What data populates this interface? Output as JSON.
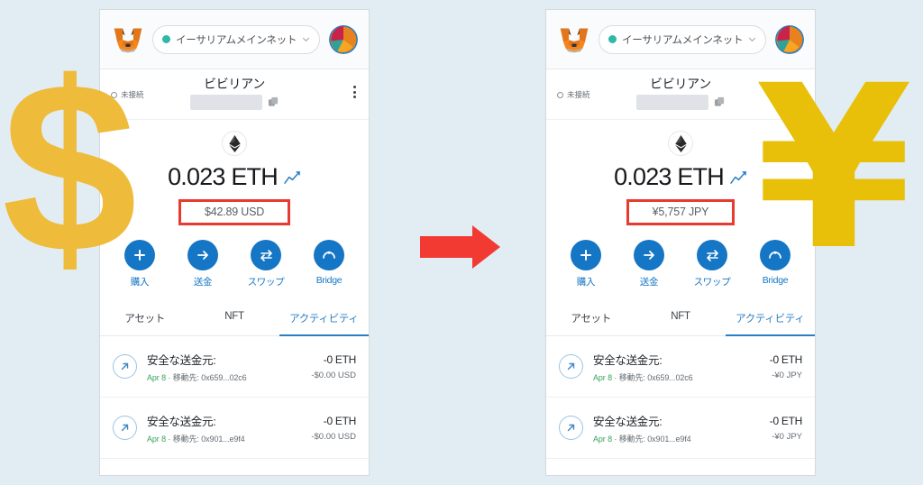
{
  "background_color": "#e2edf3",
  "overlay": {
    "left_symbol": "$",
    "left_symbol_name": "dollar-sign",
    "left_symbol_color": "#efbb3a",
    "right_symbol": "¥",
    "right_symbol_name": "yen-sign",
    "right_symbol_color": "#e8c009",
    "arrow_color": "#f23a32",
    "arrow_direction": "right"
  },
  "panels": [
    {
      "id": "before-usd",
      "topbar": {
        "wallet_logo": "metamask-fox-logo",
        "network_name": "イーサリアムメインネット",
        "network_status_color": "#2db9a5",
        "chevron": "chevron-down-icon",
        "avatar": "account-avatar-jazzicon"
      },
      "account": {
        "connection_status": "未接続",
        "name": "ビビリアン",
        "address_redacted": true,
        "copy_icon": "copy-icon",
        "menu_icon": "kebab-menu-icon"
      },
      "balance": {
        "token_icon": "ethereum-logo",
        "amount": "0.023 ETH",
        "chart_icon": "line-chart-icon",
        "fiat": "$42.89 USD",
        "fiat_highlighted": true,
        "highlight_color": "#e83a2e"
      },
      "actions": [
        {
          "icon": "plus-icon",
          "label": "購入"
        },
        {
          "icon": "arrow-right-icon",
          "label": "送金"
        },
        {
          "icon": "swap-arrows-icon",
          "label": "スワップ"
        },
        {
          "icon": "bridge-arc-icon",
          "label": "Bridge"
        }
      ],
      "tabs": [
        {
          "label": "アセット",
          "active": false
        },
        {
          "label": "NFT",
          "active": false
        },
        {
          "label": "アクティビティ",
          "active": true
        }
      ],
      "transactions": [
        {
          "icon": "arrow-up-right-icon",
          "title": "安全な送金元:",
          "date": "Apr 8",
          "detail": "移動先: 0x659...02c6",
          "amount": "-0 ETH",
          "fiat": "-$0.00 USD"
        },
        {
          "icon": "arrow-up-right-icon",
          "title": "安全な送金元:",
          "date": "Apr 8",
          "detail": "移動先: 0x901...e9f4",
          "amount": "-0 ETH",
          "fiat": "-$0.00 USD"
        }
      ]
    },
    {
      "id": "after-jpy",
      "topbar": {
        "wallet_logo": "metamask-fox-logo",
        "network_name": "イーサリアムメインネット",
        "network_status_color": "#2db9a5",
        "chevron": "chevron-down-icon",
        "avatar": "account-avatar-jazzicon"
      },
      "account": {
        "connection_status": "未接続",
        "name": "ビビリアン",
        "address_redacted": true,
        "copy_icon": "copy-icon",
        "menu_icon": "kebab-menu-icon"
      },
      "balance": {
        "token_icon": "ethereum-logo",
        "amount": "0.023 ETH",
        "chart_icon": "line-chart-icon",
        "fiat": "¥5,757 JPY",
        "fiat_highlighted": true,
        "highlight_color": "#e83a2e"
      },
      "actions": [
        {
          "icon": "plus-icon",
          "label": "購入"
        },
        {
          "icon": "arrow-right-icon",
          "label": "送金"
        },
        {
          "icon": "swap-arrows-icon",
          "label": "スワップ"
        },
        {
          "icon": "bridge-arc-icon",
          "label": "Bridge"
        }
      ],
      "tabs": [
        {
          "label": "アセット",
          "active": false
        },
        {
          "label": "NFT",
          "active": false
        },
        {
          "label": "アクティビティ",
          "active": true
        }
      ],
      "transactions": [
        {
          "icon": "arrow-up-right-icon",
          "title": "安全な送金元:",
          "date": "Apr 8",
          "detail": "移動先: 0x659...02c6",
          "amount": "-0 ETH",
          "fiat": "-¥0 JPY"
        },
        {
          "icon": "arrow-up-right-icon",
          "title": "安全な送金元:",
          "date": "Apr 8",
          "detail": "移動先: 0x901...e9f4",
          "amount": "-0 ETH",
          "fiat": "-¥0 JPY"
        }
      ]
    }
  ]
}
